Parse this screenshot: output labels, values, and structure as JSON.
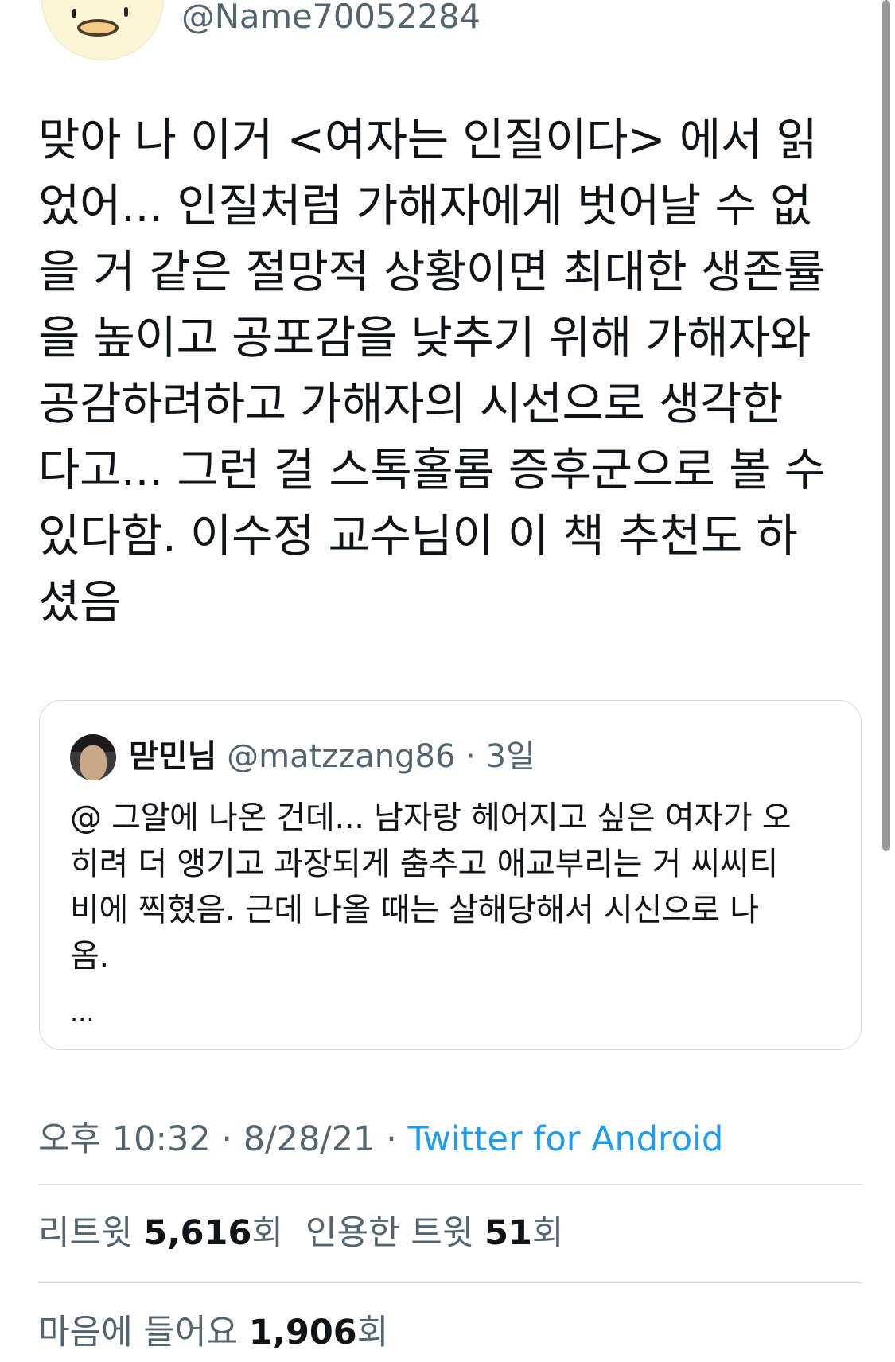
{
  "author": {
    "handle": "@Name70052284",
    "avatar_icon": "duck-face-avatar-icon"
  },
  "tweet": {
    "text": "맞아 나 이거 <여자는 인질이다> 에서 읽\n었어... 인질처럼 가해자에게 벗어날 수 없\n을 거 같은 절망적 상황이면 최대한 생존률\n을 높이고 공포감을 낮추기 위해 가해자와\n공감하려하고 가해자의 시선으로 생각한\n다고... 그런 걸 스톡홀롬 증후군으로 볼 수\n있다함. 이수정 교수님이 이 책 추천도 하\n셨음"
  },
  "quote": {
    "name": "맏민님",
    "handle": "@matzzang86",
    "separator": "·",
    "time": "3일",
    "text": "@ 그알에 나온 건데... 남자랑 헤어지고 싶은 여자가 오\n히려 더 앵기고 과장되게 춤추고 애교부리는 거 씨씨티\n비에 찍혔음. 근데 나올 때는 살해당해서 시신으로 나\n옴.",
    "more": "..."
  },
  "meta": {
    "time": "오후 10:32",
    "separator": "·",
    "date": "8/28/21",
    "source": "Twitter for Android"
  },
  "stats": {
    "retweets_label": "리트윗",
    "retweets_count": "5,616",
    "retweets_suffix": "회",
    "quotes_label": "인용한 트윗",
    "quotes_count": "51",
    "quotes_suffix": "회",
    "likes_label": "마음에 들어요",
    "likes_count": "1,906",
    "likes_suffix": "회"
  },
  "colors": {
    "text": "#0f1419",
    "secondary": "#536471",
    "link": "#1d9bf0",
    "border": "#cfd9de"
  }
}
